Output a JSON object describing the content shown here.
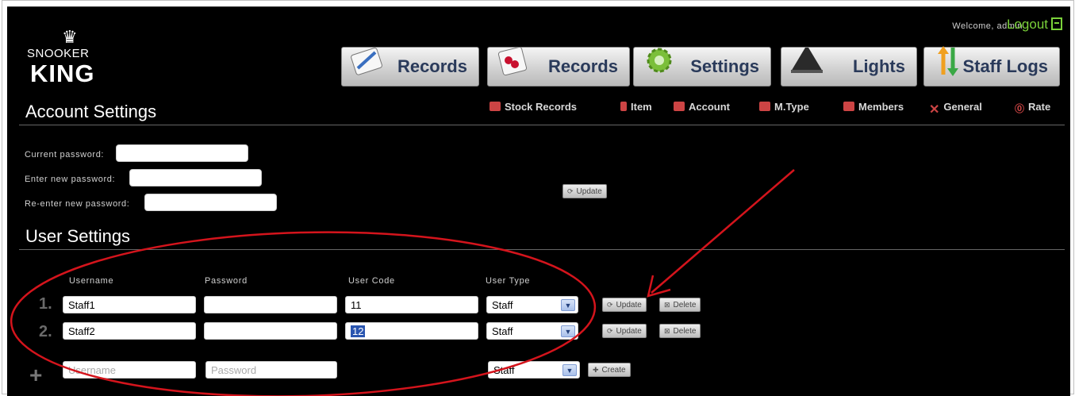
{
  "header": {
    "welcome": "Welcome, admin",
    "logout": "Logout"
  },
  "logo": {
    "line1": "SNOOKER",
    "line2": "KING"
  },
  "nav": [
    {
      "label": "Records",
      "icon": "pencil-icon"
    },
    {
      "label": "Records",
      "icon": "receipt-icon"
    },
    {
      "label": "Settings",
      "icon": "gear-icon"
    },
    {
      "label": "Lights",
      "icon": "lamp-icon"
    },
    {
      "label": "Staff Logs",
      "icon": "arrows-icon"
    }
  ],
  "subnav": [
    "Stock Records",
    "Item",
    "Account",
    "M.Type",
    "Members",
    "General",
    "Rate"
  ],
  "account": {
    "title": "Account Settings",
    "current_label": "Current password:",
    "new_label": "Enter new password:",
    "reenter_label": "Re-enter new password:",
    "update": "Update"
  },
  "users": {
    "title": "User Settings",
    "columns": [
      "Username",
      "Password",
      "User Code",
      "User Type"
    ],
    "rows": [
      {
        "num": "1.",
        "username": "Staff1",
        "password": "",
        "code": "11",
        "type": "Staff",
        "update": "Update",
        "delete": "Delete"
      },
      {
        "num": "2.",
        "username": "Staff2",
        "password": "",
        "code": "12",
        "type": "Staff",
        "update": "Update",
        "delete": "Delete"
      }
    ],
    "new_row": {
      "username_placeholder": "Username",
      "password_placeholder": "Password",
      "type": "Staff",
      "create": "Create"
    }
  },
  "colors": {
    "annotation": "#d4141c",
    "accent": "#7bd23a"
  }
}
